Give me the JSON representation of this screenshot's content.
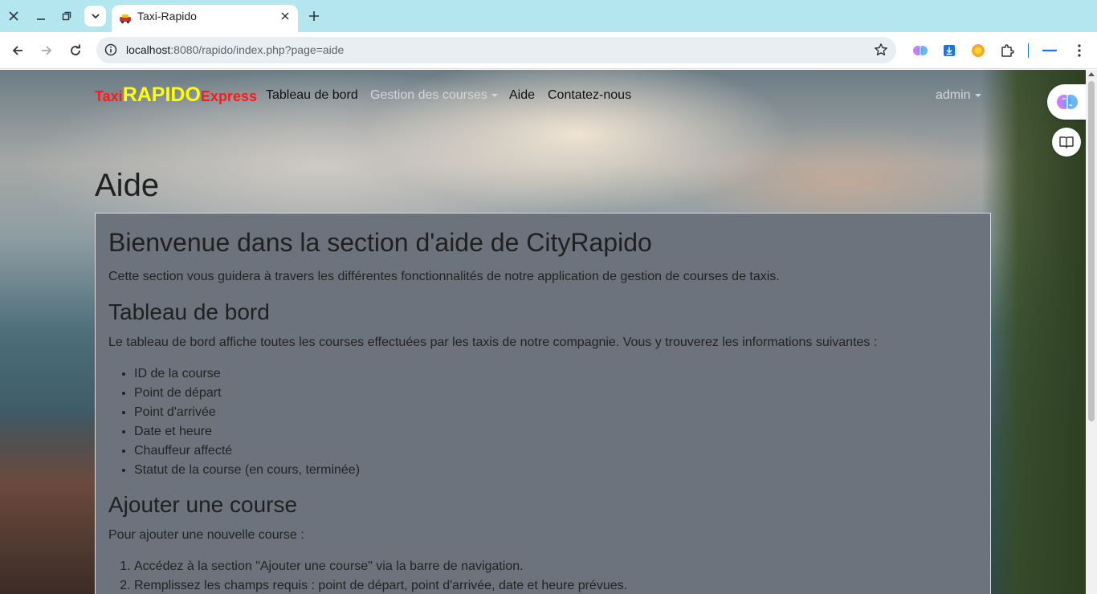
{
  "browser": {
    "tab_title": "Taxi-Rapido",
    "url_host": "localhost",
    "url_rest": ":8080/rapido/index.php?page=aide",
    "icons": [
      "close-window-icon",
      "minimize-icon",
      "restore-icon",
      "tab-search-icon",
      "new-tab-icon",
      "back-icon",
      "forward-icon",
      "reload-icon",
      "site-info-icon",
      "bookmark-star-icon",
      "extension-brain-icon",
      "extension-download-icon",
      "extension-orange-icon",
      "extensions-puzzle-icon",
      "profile-icon",
      "menu-icon"
    ]
  },
  "navbar": {
    "brand_part1": "Taxi",
    "brand_part2": "RAPIDO",
    "brand_part3": "Express",
    "brand_colors": {
      "red": "#ff1a1a",
      "yellow": "#ffff00"
    },
    "links": [
      {
        "label": "Tableau de bord"
      },
      {
        "label": "Gestion des courses"
      },
      {
        "label": "Aide"
      },
      {
        "label": "Contatez-nous"
      }
    ],
    "user": "admin"
  },
  "page": {
    "title": "Aide",
    "card": {
      "heading": "Bienvenue dans la section d'aide de CityRapido",
      "intro": "Cette section vous guidera à travers les différentes fonctionnalités de notre application de gestion de courses de taxis.",
      "section1_title": "Tableau de bord",
      "section1_text": "Le tableau de bord affiche toutes les courses effectuées par les taxis de notre compagnie. Vous y trouverez les informations suivantes :",
      "section1_items": [
        "ID de la course",
        "Point de départ",
        "Point d'arrivée",
        "Date et heure",
        "Chauffeur affecté",
        "Statut de la course (en cours, terminée)"
      ],
      "section2_title": "Ajouter une course",
      "section2_text": "Pour ajouter une nouvelle course :",
      "section2_steps": [
        "Accédez à la section \"Ajouter une course\" via la barre de navigation.",
        "Remplissez les champs requis : point de départ, point d'arrivée, date et heure prévues."
      ]
    }
  }
}
